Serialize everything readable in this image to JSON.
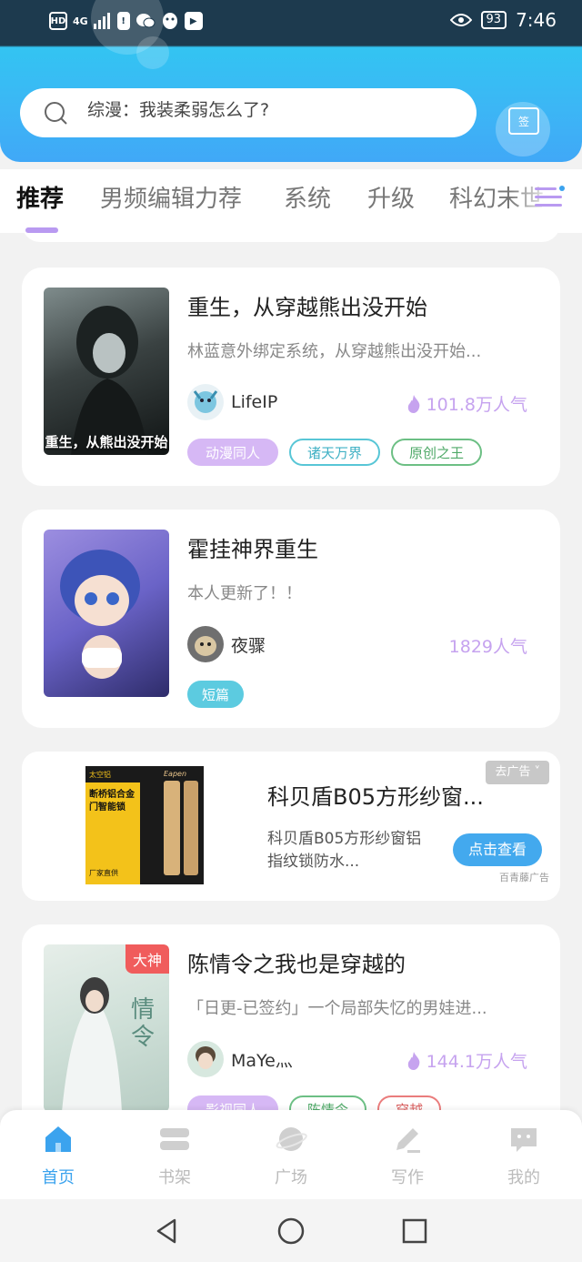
{
  "status_bar": {
    "left_labels": [
      "HD",
      "4G",
      "!"
    ],
    "battery": "93",
    "time": "7:46"
  },
  "search": {
    "placeholder": "综漫：我装柔弱怎么了?"
  },
  "gift": {
    "label": "签"
  },
  "tabs": [
    {
      "label": "推荐",
      "active": true
    },
    {
      "label": "男频编辑力荐",
      "active": false
    },
    {
      "label": "系统",
      "active": false
    },
    {
      "label": "升级",
      "active": false
    },
    {
      "label": "科幻末世",
      "active": false
    }
  ],
  "books": [
    {
      "title": "重生，从穿越熊出没开始",
      "desc": "林蓝意外绑定系统，从穿越熊出没开始...",
      "author": "LifeIP",
      "popularity": "101.8万人气",
      "cover_caption": "重生，从熊出没开始",
      "tags": [
        {
          "label": "动漫同人",
          "style": "filled-purple"
        },
        {
          "label": "诸天万界",
          "style": "outline-cyan"
        },
        {
          "label": "原创之王",
          "style": "outline-green"
        }
      ]
    },
    {
      "title": "霍挂神界重生",
      "desc": "本人更新了！！",
      "author": "夜骤",
      "popularity": "1829人气",
      "tags": [
        {
          "label": "短篇",
          "style": "filled-cyan"
        }
      ]
    },
    {
      "title": "陈情令之我也是穿越的",
      "desc": "「日更-已签约」一个局部失忆的男娃进...",
      "author": "MaYe灬",
      "popularity": "144.1万人气",
      "badge": "大神",
      "tags": [
        {
          "label": "影视同人",
          "style": "filled-purple"
        },
        {
          "label": "陈情令",
          "style": "outline-green"
        },
        {
          "label": "穿越",
          "style": "outline-red"
        }
      ]
    }
  ],
  "ad": {
    "title": "科贝盾B05方形纱窗...",
    "desc": "科贝盾B05方形纱窗铝指纹锁防水...",
    "close_label": "去广告",
    "button_label": "点击查看",
    "source": "百青藤广告",
    "image_text_1": "太空铝",
    "image_text_2": "断桥铝合金",
    "image_text_3": "门智能锁",
    "image_text_4": "厂家直供",
    "image_brand": "Eapen"
  },
  "bottom_nav": [
    {
      "label": "首页",
      "icon": "home-icon",
      "active": true
    },
    {
      "label": "书架",
      "icon": "bookshelf-icon",
      "active": false
    },
    {
      "label": "广场",
      "icon": "planet-icon",
      "active": false
    },
    {
      "label": "写作",
      "icon": "pen-icon",
      "active": false
    },
    {
      "label": "我的",
      "icon": "chat-face-icon",
      "active": false
    }
  ],
  "colors": {
    "accent_blue": "#3ba3ee",
    "accent_purple": "#b99af1",
    "popularity": "#c6a3ef"
  }
}
